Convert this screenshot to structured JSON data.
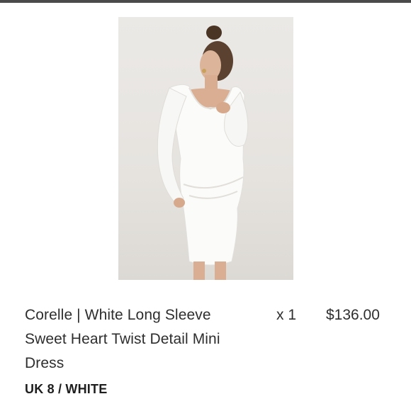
{
  "item": {
    "image_alt": "Corelle white long sleeve mini dress product photo",
    "title": "Corelle | White Long Sleeve Sweet Heart Twist Detail Mini Dress",
    "quantity": "x 1",
    "price": "$136.00",
    "variant": "UK 8 / WHITE"
  },
  "colors": {
    "top_bar": "#4a4a4a",
    "text": "#2e2e2e",
    "image_background": "#e8e6e2"
  }
}
